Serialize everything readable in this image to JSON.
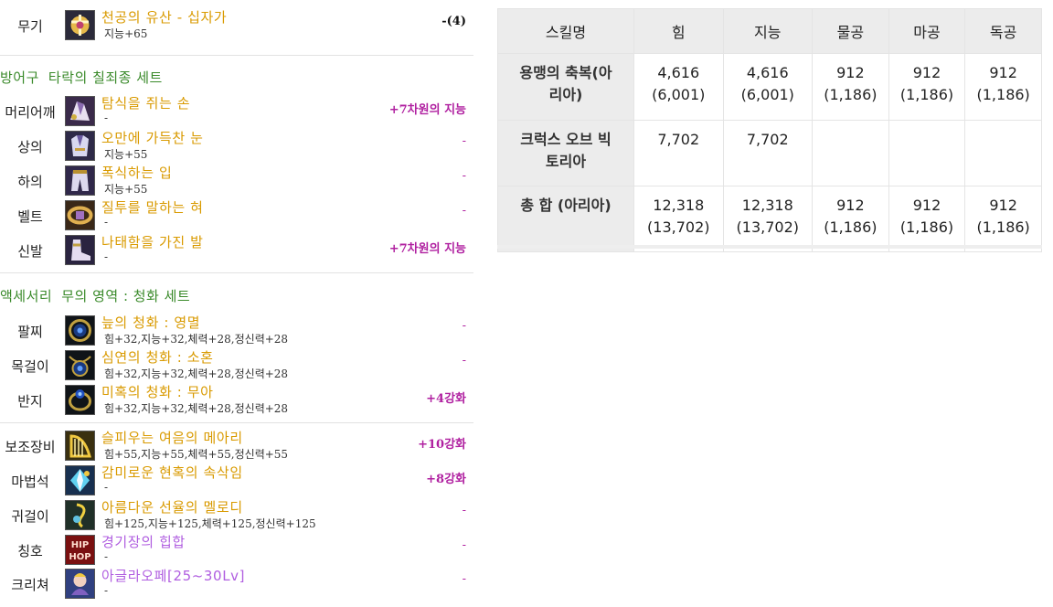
{
  "equipment": {
    "weapon": {
      "slot": "무기",
      "name": "천공의 유산 - 십자가",
      "stat": "지능+65",
      "tag": "-(4)",
      "icon": "cross-weapon-icon"
    },
    "armor_set": {
      "label": "방어구",
      "name": "타락의 칠죄종 세트",
      "items": [
        {
          "slot": "머리어깨",
          "name": "탐식을 쥐는 손",
          "stat": "-",
          "tag": "+7차원의 지능",
          "icon": "shoulder-armor-icon"
        },
        {
          "slot": "상의",
          "name": "오만에 가득찬 눈",
          "stat": "지능+55",
          "tag": "-",
          "icon": "top-armor-icon"
        },
        {
          "slot": "하의",
          "name": "폭식하는 입",
          "stat": "지능+55",
          "tag": "-",
          "icon": "bottom-armor-icon"
        },
        {
          "slot": "벨트",
          "name": "질투를 말하는 혀",
          "stat": "-",
          "tag": "-",
          "icon": "belt-icon"
        },
        {
          "slot": "신발",
          "name": "나태함을 가진 발",
          "stat": "-",
          "tag": "+7차원의 지능",
          "icon": "shoes-icon"
        }
      ]
    },
    "accessory_set": {
      "label": "액세서리",
      "name": "무의 영역 : 청화 세트",
      "items": [
        {
          "slot": "팔찌",
          "name": "늪의 청화 : 영멸",
          "stat": "힘+32,지능+32,체력+28,정신력+28",
          "tag": "-",
          "icon": "bracelet-icon"
        },
        {
          "slot": "목걸이",
          "name": "심연의 청화 : 소혼",
          "stat": "힘+32,지능+32,체력+28,정신력+28",
          "tag": "-",
          "icon": "necklace-icon"
        },
        {
          "slot": "반지",
          "name": "미혹의 청화 : 무아",
          "stat": "힘+32,지능+32,체력+28,정신력+28",
          "tag": "+4강화",
          "icon": "ring-icon"
        }
      ]
    },
    "extras": [
      {
        "slot": "보조장비",
        "name": "슬피우는 여음의 메아리",
        "stat": "힘+55,지능+55,체력+55,정신력+55",
        "tag": "+10강화",
        "icon": "harp-icon",
        "color": "#d99a00"
      },
      {
        "slot": "마법석",
        "name": "감미로운 현혹의 속삭임",
        "stat": "-",
        "tag": "+8강화",
        "icon": "magic-stone-icon",
        "color": "#d99a00"
      },
      {
        "slot": "귀걸이",
        "name": "아름다운 선율의 멜로디",
        "stat": "힘+125,지능+125,체력+125,정신력+125",
        "tag": "-",
        "icon": "earring-icon",
        "color": "#d99a00"
      },
      {
        "slot": "칭호",
        "name": "경기장의 힙합",
        "stat": "-",
        "tag": "-",
        "icon": "hiphop-title-icon",
        "icon_text_1": "HIP",
        "icon_text_2": "HOP",
        "color": "#b05ee0"
      },
      {
        "slot": "크리쳐",
        "name": "아글라오페[25~30Lv]",
        "stat": "-",
        "tag": "-",
        "icon": "creature-icon",
        "color": "#b05ee0"
      }
    ]
  },
  "skill_table": {
    "headers": [
      "스킬명",
      "힘",
      "지능",
      "물공",
      "마공",
      "독공"
    ],
    "rows": [
      {
        "name": "용맹의 축복(아리아)",
        "name_l1": "용맹의 축복(아",
        "name_l2": "리아)",
        "values": [
          [
            "4,616",
            "(6,001)"
          ],
          [
            "4,616",
            "(6,001)"
          ],
          [
            "912",
            "(1,186)"
          ],
          [
            "912",
            "(1,186)"
          ],
          [
            "912",
            "(1,186)"
          ]
        ]
      },
      {
        "name": "크럭스 오브 빅토리아",
        "name_l1": "크럭스 오브 빅",
        "name_l2": "토리아",
        "values": [
          [
            "7,702",
            ""
          ],
          [
            "7,702",
            ""
          ],
          [
            "",
            ""
          ],
          [
            "",
            ""
          ],
          [
            "",
            ""
          ]
        ]
      },
      {
        "name": "총 합 (아리아)",
        "name_l1": "총 합 (아리아)",
        "name_l2": "",
        "values": [
          [
            "12,318",
            "(13,702)"
          ],
          [
            "12,318",
            "(13,702)"
          ],
          [
            "912",
            "(1,186)"
          ],
          [
            "912",
            "(1,186)"
          ],
          [
            "912",
            "(1,186)"
          ]
        ]
      }
    ]
  },
  "colors": {
    "item_name_gold": "#d99a00",
    "item_name_purple": "#b05ee0",
    "set_header_green": "#3a8a2a",
    "tag_magenta": "#b020a0",
    "table_header_bg": "#ececec"
  }
}
